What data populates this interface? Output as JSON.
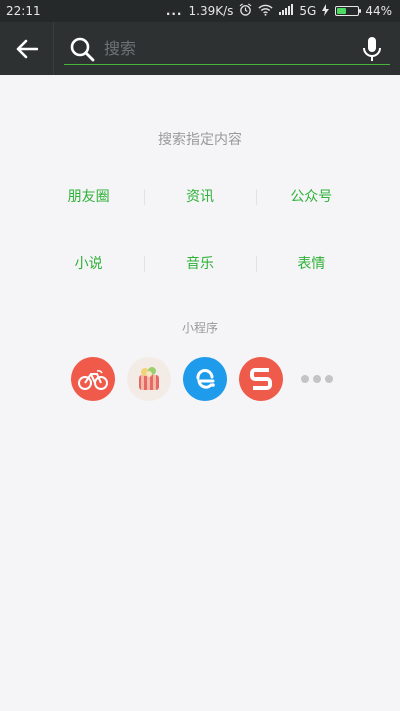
{
  "status_bar": {
    "time": "22:11",
    "dots": "...",
    "speed": "1.39K/s",
    "network": "5G",
    "battery": "44%",
    "battery_level": 0.44
  },
  "search": {
    "placeholder": "搜索"
  },
  "main": {
    "hint": "搜索指定内容",
    "categories": [
      [
        "朋友圈",
        "资讯",
        "公众号"
      ],
      [
        "小说",
        "音乐",
        "表情"
      ]
    ],
    "mini_programs_title": "小程序"
  },
  "colors": {
    "accent_green": "#2eb137",
    "topbar_bg": "#2e3132",
    "page_bg": "#f5f5f7"
  },
  "icons": [
    "back-arrow-icon",
    "search-icon",
    "microphone-icon",
    "bike-app-icon",
    "food-app-icon",
    "e-app-icon",
    "s-app-icon",
    "more-dots-icon"
  ]
}
